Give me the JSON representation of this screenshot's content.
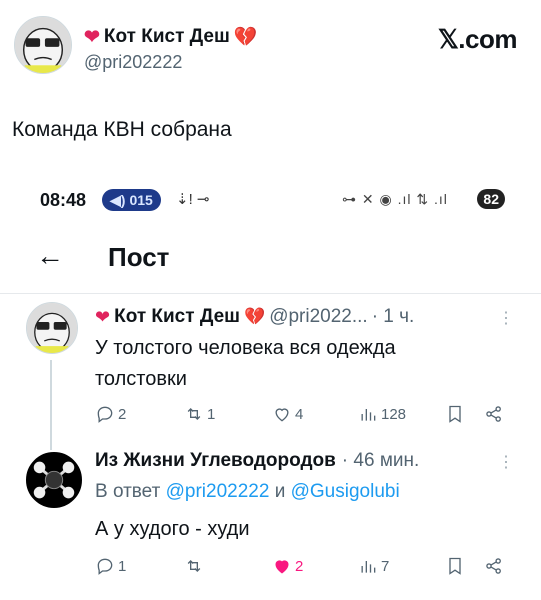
{
  "outer_tweet": {
    "display_name": "Кот Кист Деш",
    "handle": "@pri202222",
    "site_label": "𝕏.com",
    "text": "Команда КВН собрана"
  },
  "status_bar": {
    "time": "08:48",
    "pill_label": "015",
    "battery": "82"
  },
  "post_header": {
    "back_icon": "arrow-left-icon",
    "title": "Пост"
  },
  "thread": {
    "tweets": [
      {
        "display_name": "Кот Кист Деш",
        "handle": "@pri2022...",
        "time": "· 1 ч.",
        "text_line1": "У толстого человека вся одежда",
        "text_line2": "толстовки",
        "replies": "2",
        "retweets": "1",
        "likes": "4",
        "views": "128"
      },
      {
        "display_name": "Из Жизни Углеводородов",
        "time": "· 46 мин.",
        "reply_prefix": "В ответ",
        "reply_to_1": "@pri202222",
        "reply_and": "и",
        "reply_to_2": "@Gusigolubi",
        "text": "А у худого - худи",
        "replies": "1",
        "retweets": "",
        "likes": "2",
        "views": "7"
      }
    ]
  },
  "colors": {
    "link": "#1d9bf0",
    "like_active": "#f91880",
    "secondary_text": "#536471"
  }
}
